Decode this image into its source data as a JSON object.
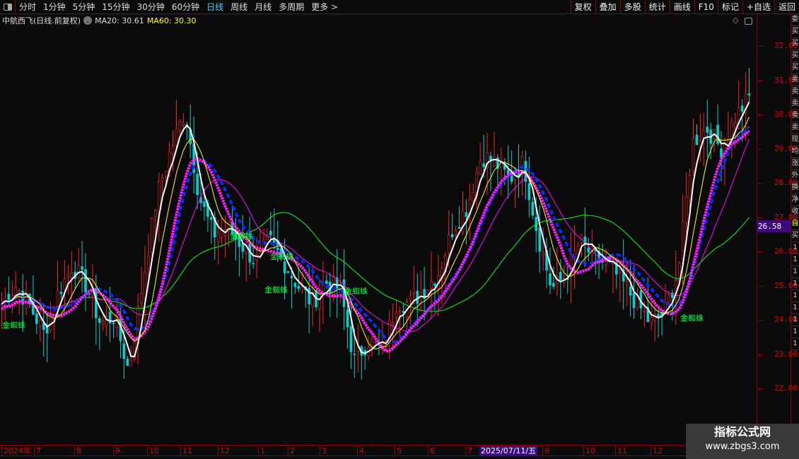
{
  "toolbar": {
    "periods": [
      "分时",
      "1分钟",
      "5分钟",
      "15分钟",
      "30分钟",
      "60分钟",
      "日线",
      "周线",
      "月线",
      "多周期",
      "更多 >"
    ],
    "active": "日线",
    "right_buttons": [
      "复权",
      "叠加",
      "多股",
      "统计",
      "画线",
      "F10",
      "标记",
      "+自选",
      "返回"
    ]
  },
  "info": {
    "title": "中航西飞(日线.前复权)",
    "ma20": "MA20: 30.61",
    "ma60": "MA60: 30.30"
  },
  "axis": {
    "y_labels": [
      "32.00",
      "31.00",
      "30.00",
      "29.00",
      "28.00",
      "27.00",
      "26.00",
      "25.00",
      "24.00",
      "23.00",
      "22.00"
    ],
    "current_price": "26.58"
  },
  "xaxis": {
    "labels": [
      "2024年",
      "7",
      "8",
      "9",
      "10",
      "11",
      "12",
      "1",
      "2",
      "3",
      "4",
      "5",
      "6",
      "7",
      "9",
      "10",
      "11",
      "12"
    ],
    "cursor_date": "2025/07/11/五"
  },
  "signals": [
    "金蜘蛛",
    "金蜘蛛",
    "金蜘蛛",
    "金蜘蛛",
    "金蜘蛛",
    "金蜘蛛"
  ],
  "right_panel": [
    "委",
    "买",
    "买",
    "买",
    "买",
    "卖",
    "卖",
    "卖",
    "卖",
    "卖",
    "现",
    "均",
    "涨",
    "外",
    "换",
    "净",
    "收",
    "自",
    "买",
    "1",
    "1",
    "1",
    "1",
    "1",
    "1",
    "1",
    "1",
    "1"
  ],
  "watermark": {
    "title": "指标公式网",
    "url": "www.zbgs3.com"
  },
  "colors": {
    "up": "#ff2020",
    "down": "#00d0d0",
    "ma5": "#ffffff",
    "ma10": "#ffff00",
    "ma20": "#ff00ff",
    "ma60": "#00ff00",
    "thick": "#ff20ff",
    "blue": "#0030ff"
  },
  "chart_data": {
    "type": "candlestick",
    "ylim": [
      21.0,
      32.9
    ],
    "close_trend": [
      24.47,
      25.0,
      24.4,
      23.6,
      24.8,
      25.6,
      25.0,
      23.9,
      24.1,
      22.5,
      25.1,
      27.6,
      29.0,
      30.1,
      27.6,
      26.5,
      26.7,
      26.2,
      25.7,
      26.3,
      25.7,
      25.0,
      24.5,
      25.1,
      24.9,
      22.8,
      23.4,
      23.1,
      24.5,
      24.5,
      24.9,
      25.4,
      26.7,
      27.3,
      28.8,
      28.6,
      28.1,
      28.6,
      26.5,
      24.9,
      25.3,
      26.3,
      25.8,
      25.6,
      25.1,
      24.5,
      23.9,
      24.2,
      25.5,
      29.2,
      29.6,
      29.0,
      29.9,
      30.5
    ]
  }
}
